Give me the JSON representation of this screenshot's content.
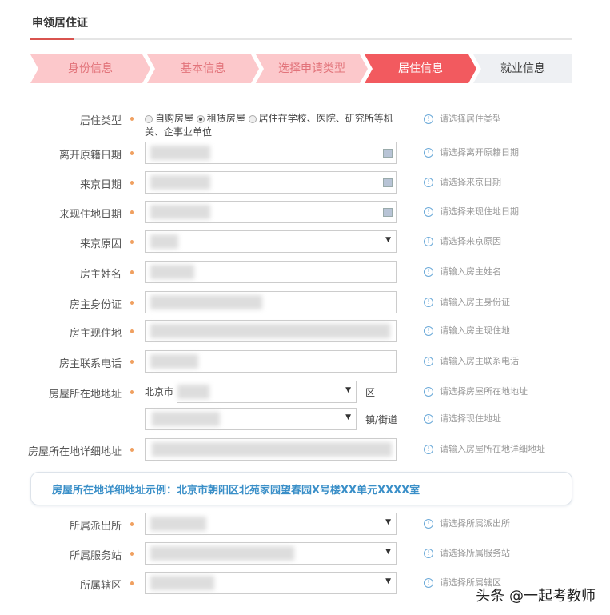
{
  "page_title": "申领居住证",
  "steps": [
    {
      "label": "身份信息",
      "state": "done"
    },
    {
      "label": "基本信息",
      "state": "done"
    },
    {
      "label": "选择申请类型",
      "state": "done"
    },
    {
      "label": "居住信息",
      "state": "current"
    },
    {
      "label": "就业信息",
      "state": "todo"
    }
  ],
  "residence_type": {
    "label": "居住类型",
    "options": [
      "自购房屋",
      "租赁房屋",
      "居住在学校、医院、研究所等机关、企事业单位"
    ],
    "selected": "租赁房屋",
    "hint": "请选择居住类型"
  },
  "fields": [
    {
      "label": "离开原籍日期",
      "hint": "请选择离开原籍日期"
    },
    {
      "label": "来京日期",
      "hint": "请选择来京日期"
    },
    {
      "label": "来现住地日期",
      "hint": "请选择来现住地日期"
    },
    {
      "label": "来京原因",
      "hint": "请选择来京原因"
    },
    {
      "label": "房主姓名",
      "hint": "请输入房主姓名"
    },
    {
      "label": "房主身份证",
      "hint": "请输入房主身份证"
    },
    {
      "label": "房主现住地",
      "hint": "请输入房主现住地"
    },
    {
      "label": "房主联系电话",
      "hint": "请输入房主联系电话"
    }
  ],
  "address": {
    "label": "房屋所在地地址",
    "city": "北京市",
    "district_suffix": "区",
    "street_suffix": "镇/街道",
    "hint": "请选择房屋所在地地址",
    "street_hint": "请选择现住地址"
  },
  "detail_address": {
    "label": "房屋所在地详细地址",
    "hint": "请输入房屋所在地详细地址",
    "example": "房屋所在地详细地址示例：北京市朝阳区北苑家园望春园X号楼XX单元XXXX室"
  },
  "bottom_fields": [
    {
      "label": "所属派出所",
      "hint": "请选择所属派出所"
    },
    {
      "label": "所属服务站",
      "hint": "请选择所属服务站"
    },
    {
      "label": "所属辖区",
      "hint": "请选择所属辖区"
    }
  ],
  "watermark": "头条 @一起考教师"
}
